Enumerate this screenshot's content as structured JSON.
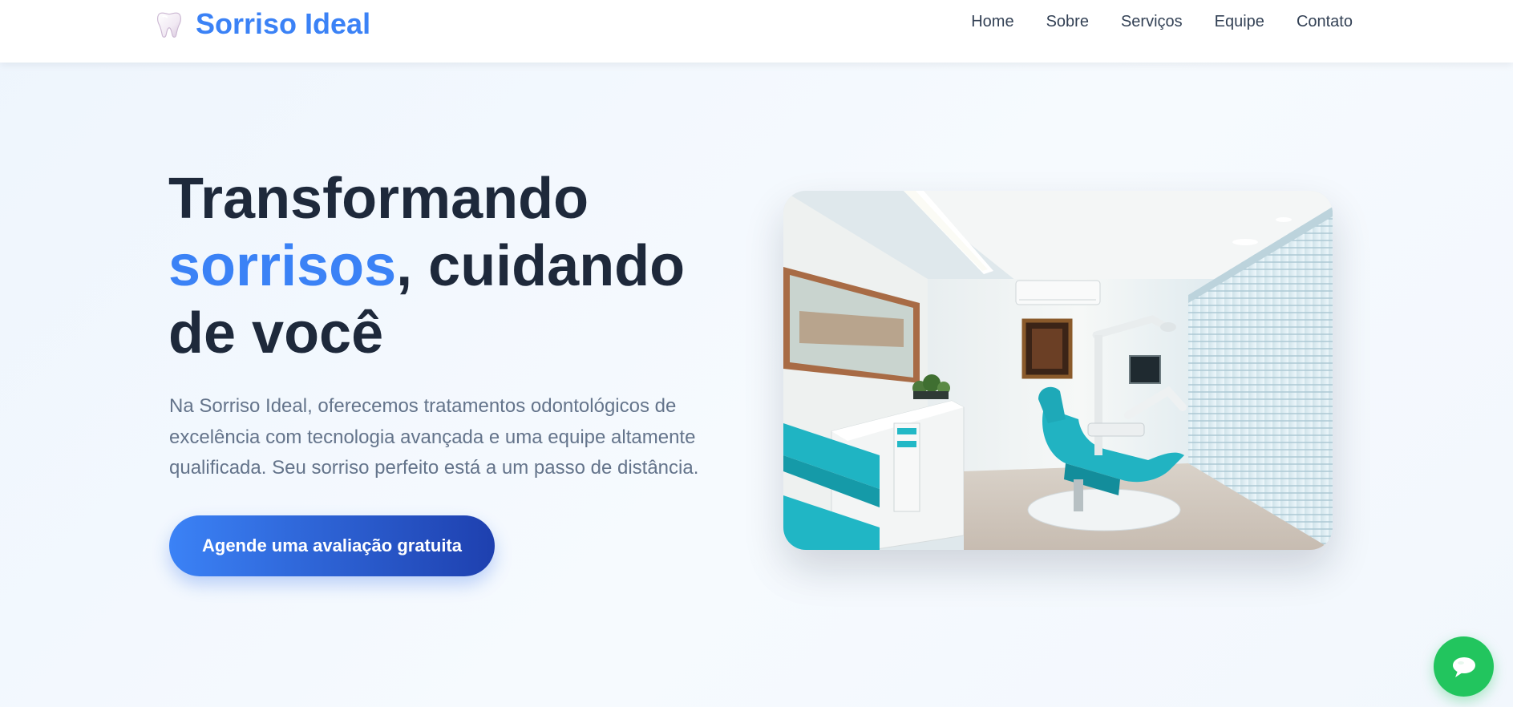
{
  "header": {
    "brand": "Sorriso Ideal",
    "logo_icon": "tooth-icon",
    "nav": [
      {
        "label": "Home"
      },
      {
        "label": "Sobre"
      },
      {
        "label": "Serviços"
      },
      {
        "label": "Equipe"
      },
      {
        "label": "Contato"
      }
    ]
  },
  "hero": {
    "title_line1": "Transformando",
    "title_accent": "sorrisos",
    "title_line2_rest": ", cuidando",
    "title_line3": "de você",
    "description": "Na Sorriso Ideal, oferecemos tratamentos odontológicos de excelência com tecnologia avançada e uma equipe altamente qualificada. Seu sorriso perfeito está a um passo de distância.",
    "cta_label": "Agende uma avaliação gratuita",
    "image_subject": "dental-clinic-room-photo"
  },
  "floating": {
    "icon": "chat-icon"
  },
  "colors": {
    "brand": "#3b82f6",
    "heading": "#1e293b",
    "body_text": "#64748b",
    "cta_start": "#3b82f6",
    "cta_end": "#1e40af",
    "whatsapp": "#22c55e"
  }
}
